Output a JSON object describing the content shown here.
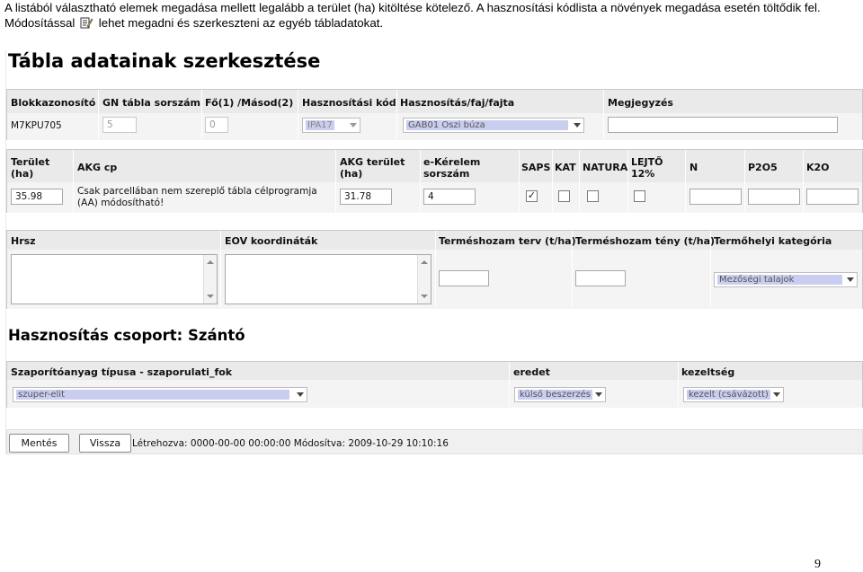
{
  "intro": {
    "part1": "A listából választható elemek megadása mellett legalább a terület (ha) kitöltése kötelező. A hasznosítási kódlista a növények megadása esetén töltődik fel. Módosítással",
    "part2": "lehet megadni és szerkeszteni az egyéb tábladatokat.",
    "icon": "edit-pencil-icon"
  },
  "page_title": "Tábla adatainak szerkesztése",
  "row1": {
    "labels": {
      "block_id": "Blokkazonosító",
      "gn_table": "GN tábla sorszám",
      "main_sub": "Fő(1) /Másod(2)",
      "usage_code": "Hasznosítási kód",
      "usage_species": "Hasznosítás/faj/fajta",
      "note": "Megjegyzés"
    },
    "values": {
      "block_id": "M7KPU705",
      "gn_table": "5",
      "main_sub": "0",
      "usage_code": "IPA17",
      "usage_species": "GAB01 Őszi búza",
      "note": ""
    }
  },
  "row2": {
    "labels": {
      "area": "Terület (ha)",
      "akg_cp": "AKG cp",
      "akg_area": "AKG terület (ha)",
      "ekerelem": "e-Kérelem sorszám",
      "saps": "SAPS",
      "kat": "KAT",
      "natura": "NATURA",
      "lejto": "LEJTŐ 12%",
      "n": "N",
      "p2o5": "P2O5",
      "k2o": "K2O"
    },
    "values": {
      "area": "35.98",
      "akg_cp_note": "Csak parcellában nem szereplő tábla célprogramja (AA) módosítható!",
      "akg_area": "31.78",
      "ekerelem": "4",
      "saps": true,
      "kat": false,
      "natura": false,
      "lejto": false,
      "n": "",
      "p2o5": "",
      "k2o": ""
    }
  },
  "row3": {
    "labels": {
      "hrsz": "Hrsz",
      "eov": "EOV koordináták",
      "yield_plan": "Terméshozam terv (t/ha)",
      "yield_actual": "Terméshozam tény (t/ha)",
      "site_category": "Termőhelyi kategória"
    },
    "values": {
      "hrsz": "",
      "eov": "",
      "yield_plan": "",
      "yield_actual": "",
      "site_category": "Mezőségi talajok"
    }
  },
  "group_title": "Hasznosítás csoport: Szántó",
  "row4": {
    "labels": {
      "propagation": "Szaporítóanyag típusa - szaporulati_fok",
      "origin": "eredet",
      "treatment": "kezeltség"
    },
    "values": {
      "propagation": "szuper-elit",
      "origin": "külső beszerzés",
      "treatment": "kezelt (csávázott)"
    }
  },
  "footer": {
    "save_label": "Mentés",
    "back_label": "Vissza",
    "meta": "Létrehozva: 0000-00-00 00:00:00 Módosítva: 2009-10-29 10:10:16"
  },
  "page_number": "9"
}
